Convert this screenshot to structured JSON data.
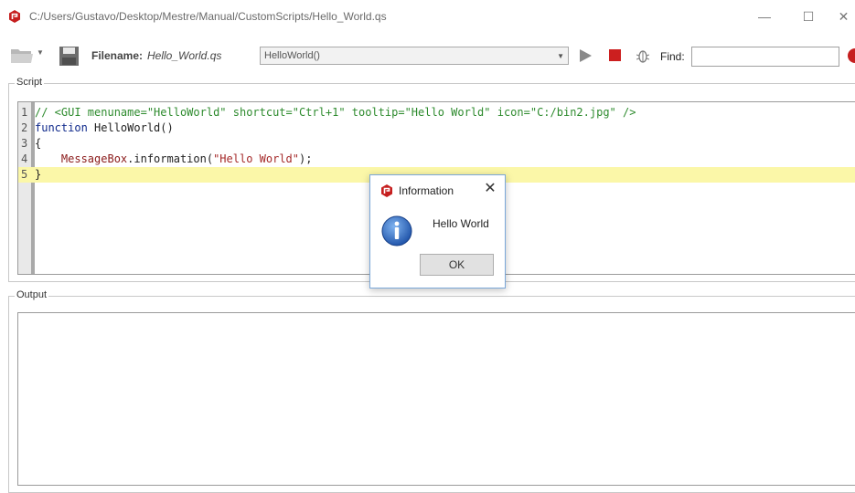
{
  "window": {
    "title": "C:/Users/Gustavo/Desktop/Mestre/Manual/CustomScripts/Hello_World.qs",
    "min_glyph": "—",
    "max_glyph": "☐",
    "close_glyph": "✕"
  },
  "toolbar": {
    "open_icon": "folder-icon",
    "save_icon": "save-icon",
    "filename_label": "Filename:",
    "filename_value": "Hello_World.qs",
    "function_selected": "HelloWorld()",
    "run_icon": "play-icon",
    "stop_icon": "stop-icon",
    "debug_icon": "bug-icon",
    "find_label": "Find:",
    "find_value": ""
  },
  "script": {
    "legend": "Script",
    "current_line": 5,
    "lines": [
      {
        "n": "1",
        "parts": [
          {
            "t": "// <GUI menuname=\"HelloWorld\" shortcut=\"Ctrl+1\" tooltip=\"Hello World\" icon=\"C:/bin2.jpg\" />",
            "c": "c-comment"
          }
        ]
      },
      {
        "n": "2",
        "parts": [
          {
            "t": "function",
            "c": "c-keyword"
          },
          {
            "t": " HelloWorld()",
            "c": "c-plain"
          }
        ]
      },
      {
        "n": "3",
        "parts": [
          {
            "t": "{",
            "c": "c-plain"
          }
        ]
      },
      {
        "n": "4",
        "parts": [
          {
            "t": "    MessageBox",
            "c": "c-call"
          },
          {
            "t": ".information(",
            "c": "c-plain"
          },
          {
            "t": "\"Hello World\"",
            "c": "c-string"
          },
          {
            "t": ");",
            "c": "c-plain"
          }
        ]
      },
      {
        "n": "5",
        "parts": [
          {
            "t": "}",
            "c": "c-plain"
          }
        ]
      }
    ]
  },
  "output": {
    "legend": "Output"
  },
  "dialog": {
    "title": "Information",
    "close_glyph": "✕",
    "message": "Hello World",
    "ok_label": "OK"
  },
  "colors": {
    "brand_red": "#c61f1f",
    "current_line_highlight": "#fbf7a8",
    "comment_green": "#2e8b2e",
    "keyword_blue": "#102a8c"
  }
}
